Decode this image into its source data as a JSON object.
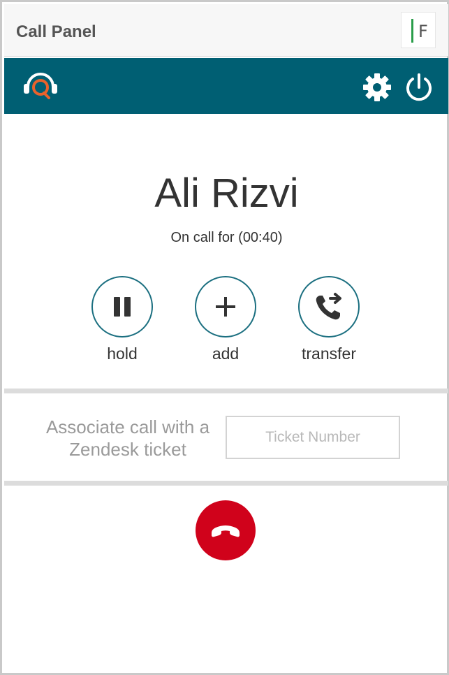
{
  "window": {
    "title": "Call Panel",
    "app_badge_letter": "F"
  },
  "toolbar": {
    "logo_icon": "headset-logo-icon",
    "settings_icon": "gear-icon",
    "power_icon": "power-icon",
    "color": "#005f73"
  },
  "call": {
    "caller_name": "Ali Rizvi",
    "duration_text": "On call for (00:40)"
  },
  "actions": [
    {
      "label": "hold",
      "icon": "pause-icon"
    },
    {
      "label": "add",
      "icon": "plus-icon"
    },
    {
      "label": "transfer",
      "icon": "phone-transfer-icon"
    }
  ],
  "association": {
    "text": "Associate call with a Zendesk ticket",
    "ticket_placeholder": "Ticket Number",
    "ticket_value": ""
  },
  "hangup": {
    "icon": "hang-up-icon",
    "color": "#d0021b"
  }
}
